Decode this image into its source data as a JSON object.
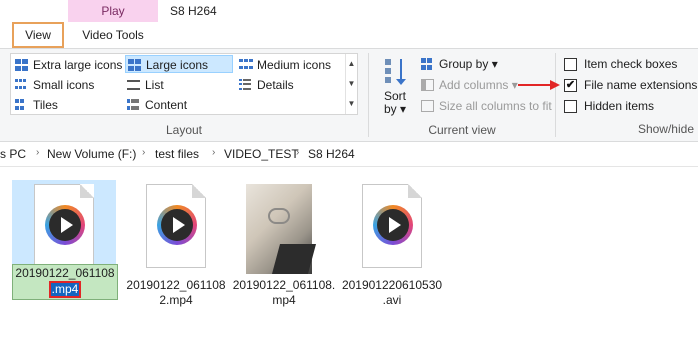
{
  "tabs": {
    "play_label": "Play",
    "window_title": "S8 H264",
    "view_label": "View",
    "video_tools_label": "Video Tools"
  },
  "layout": {
    "items": [
      {
        "label": "Extra large icons",
        "icon": "extra-large-icons-icon"
      },
      {
        "label": "Large icons",
        "icon": "large-icons-icon",
        "selected": true
      },
      {
        "label": "Medium icons",
        "icon": "medium-icons-icon"
      },
      {
        "label": "Small icons",
        "icon": "small-icons-icon"
      },
      {
        "label": "List",
        "icon": "list-icon"
      },
      {
        "label": "Details",
        "icon": "details-icon"
      },
      {
        "label": "Tiles",
        "icon": "tiles-icon"
      },
      {
        "label": "Content",
        "icon": "content-icon"
      }
    ],
    "group_label": "Layout"
  },
  "current_view": {
    "sort_line1": "Sort",
    "sort_line2": "by",
    "group_by": "Group by",
    "add_columns": "Add columns",
    "size_all": "Size all columns to fit",
    "group_label": "Current view"
  },
  "show_hide": {
    "item_checkboxes": "Item check boxes",
    "file_name_extensions": "File name extensions",
    "hidden_items": "Hidden items",
    "group_label": "Show/hide",
    "extensions_checked": true,
    "checkmark": "✔"
  },
  "breadcrumb": {
    "items": [
      "s PC",
      "New Volume (F:)",
      "test files",
      "VIDEO_TEST",
      "S8 H264"
    ],
    "separator": "›"
  },
  "files": [
    {
      "name_line1": "20190122_061108",
      "name_ext": ".mp4",
      "editing": true
    },
    {
      "name_line1": "20190122_061108",
      "name_line2": "2.mp4"
    },
    {
      "name_line1": "20190122_061108.",
      "name_line2": "mp4"
    },
    {
      "name_line1": "201901220610530",
      "name_line2": ".avi"
    }
  ],
  "colors": {
    "accent_orange": "#e8a15a",
    "play_tab_pink": "#f9d2ee",
    "selection_blue": "#cce8ff",
    "arrow_red": "#e22626"
  }
}
